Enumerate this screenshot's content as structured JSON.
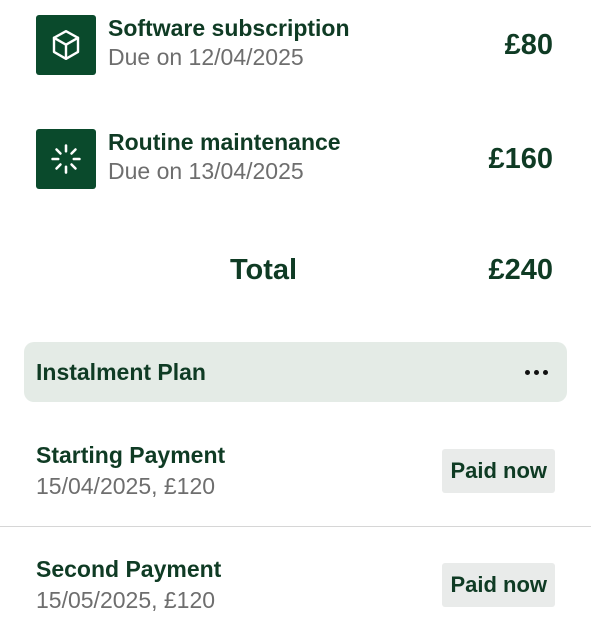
{
  "bills": [
    {
      "icon": "box-icon",
      "title": "Software subscription",
      "due": "Due on 12/04/2025",
      "amount": "£80"
    },
    {
      "icon": "loading-spinner-icon",
      "title": "Routine maintenance",
      "due": "Due on 13/04/2025",
      "amount": "£160"
    }
  ],
  "total": {
    "label": "Total",
    "amount": "£240"
  },
  "plan": {
    "title": "Instalment Plan",
    "more_icon": "more-horizontal-icon"
  },
  "payments": [
    {
      "title": "Starting Payment",
      "detail": "15/04/2025, £120",
      "status": "Paid now"
    },
    {
      "title": "Second Payment",
      "detail": "15/05/2025, £120",
      "status": "Paid now"
    }
  ],
  "colors": {
    "brand_green": "#0a4a2c",
    "text_dark": "#0f3b24",
    "text_muted": "#6e6e6e",
    "plan_header_bg": "#e4ebe6",
    "badge_bg": "#e9ebea"
  }
}
